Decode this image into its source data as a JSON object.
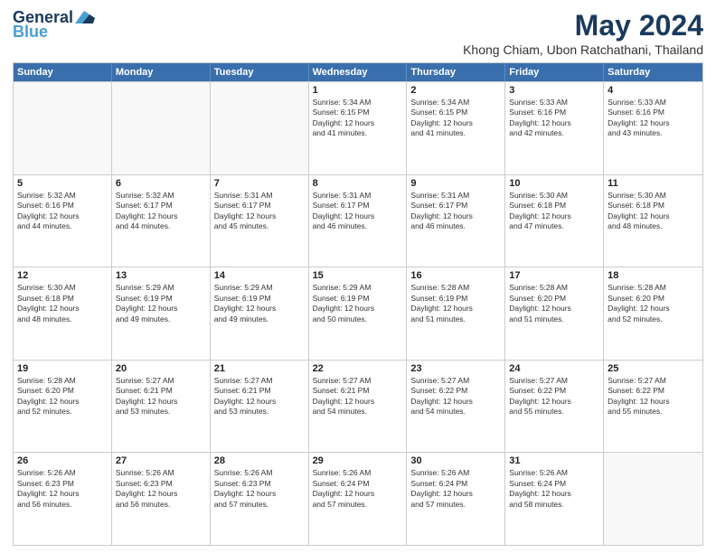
{
  "logo": {
    "line1": "General",
    "line2": "Blue"
  },
  "title": "May 2024",
  "subtitle": "Khong Chiam, Ubon Ratchathani, Thailand",
  "header_days": [
    "Sunday",
    "Monday",
    "Tuesday",
    "Wednesday",
    "Thursday",
    "Friday",
    "Saturday"
  ],
  "weeks": [
    [
      {
        "day": "",
        "info": "",
        "empty": true
      },
      {
        "day": "",
        "info": "",
        "empty": true
      },
      {
        "day": "",
        "info": "",
        "empty": true
      },
      {
        "day": "1",
        "info": "Sunrise: 5:34 AM\nSunset: 6:15 PM\nDaylight: 12 hours\nand 41 minutes."
      },
      {
        "day": "2",
        "info": "Sunrise: 5:34 AM\nSunset: 6:15 PM\nDaylight: 12 hours\nand 41 minutes."
      },
      {
        "day": "3",
        "info": "Sunrise: 5:33 AM\nSunset: 6:16 PM\nDaylight: 12 hours\nand 42 minutes."
      },
      {
        "day": "4",
        "info": "Sunrise: 5:33 AM\nSunset: 6:16 PM\nDaylight: 12 hours\nand 43 minutes."
      }
    ],
    [
      {
        "day": "5",
        "info": "Sunrise: 5:32 AM\nSunset: 6:16 PM\nDaylight: 12 hours\nand 44 minutes."
      },
      {
        "day": "6",
        "info": "Sunrise: 5:32 AM\nSunset: 6:17 PM\nDaylight: 12 hours\nand 44 minutes."
      },
      {
        "day": "7",
        "info": "Sunrise: 5:31 AM\nSunset: 6:17 PM\nDaylight: 12 hours\nand 45 minutes."
      },
      {
        "day": "8",
        "info": "Sunrise: 5:31 AM\nSunset: 6:17 PM\nDaylight: 12 hours\nand 46 minutes."
      },
      {
        "day": "9",
        "info": "Sunrise: 5:31 AM\nSunset: 6:17 PM\nDaylight: 12 hours\nand 46 minutes."
      },
      {
        "day": "10",
        "info": "Sunrise: 5:30 AM\nSunset: 6:18 PM\nDaylight: 12 hours\nand 47 minutes."
      },
      {
        "day": "11",
        "info": "Sunrise: 5:30 AM\nSunset: 6:18 PM\nDaylight: 12 hours\nand 48 minutes."
      }
    ],
    [
      {
        "day": "12",
        "info": "Sunrise: 5:30 AM\nSunset: 6:18 PM\nDaylight: 12 hours\nand 48 minutes."
      },
      {
        "day": "13",
        "info": "Sunrise: 5:29 AM\nSunset: 6:19 PM\nDaylight: 12 hours\nand 49 minutes."
      },
      {
        "day": "14",
        "info": "Sunrise: 5:29 AM\nSunset: 6:19 PM\nDaylight: 12 hours\nand 49 minutes."
      },
      {
        "day": "15",
        "info": "Sunrise: 5:29 AM\nSunset: 6:19 PM\nDaylight: 12 hours\nand 50 minutes."
      },
      {
        "day": "16",
        "info": "Sunrise: 5:28 AM\nSunset: 6:19 PM\nDaylight: 12 hours\nand 51 minutes."
      },
      {
        "day": "17",
        "info": "Sunrise: 5:28 AM\nSunset: 6:20 PM\nDaylight: 12 hours\nand 51 minutes."
      },
      {
        "day": "18",
        "info": "Sunrise: 5:28 AM\nSunset: 6:20 PM\nDaylight: 12 hours\nand 52 minutes."
      }
    ],
    [
      {
        "day": "19",
        "info": "Sunrise: 5:28 AM\nSunset: 6:20 PM\nDaylight: 12 hours\nand 52 minutes."
      },
      {
        "day": "20",
        "info": "Sunrise: 5:27 AM\nSunset: 6:21 PM\nDaylight: 12 hours\nand 53 minutes."
      },
      {
        "day": "21",
        "info": "Sunrise: 5:27 AM\nSunset: 6:21 PM\nDaylight: 12 hours\nand 53 minutes."
      },
      {
        "day": "22",
        "info": "Sunrise: 5:27 AM\nSunset: 6:21 PM\nDaylight: 12 hours\nand 54 minutes."
      },
      {
        "day": "23",
        "info": "Sunrise: 5:27 AM\nSunset: 6:22 PM\nDaylight: 12 hours\nand 54 minutes."
      },
      {
        "day": "24",
        "info": "Sunrise: 5:27 AM\nSunset: 6:22 PM\nDaylight: 12 hours\nand 55 minutes."
      },
      {
        "day": "25",
        "info": "Sunrise: 5:27 AM\nSunset: 6:22 PM\nDaylight: 12 hours\nand 55 minutes."
      }
    ],
    [
      {
        "day": "26",
        "info": "Sunrise: 5:26 AM\nSunset: 6:23 PM\nDaylight: 12 hours\nand 56 minutes."
      },
      {
        "day": "27",
        "info": "Sunrise: 5:26 AM\nSunset: 6:23 PM\nDaylight: 12 hours\nand 56 minutes."
      },
      {
        "day": "28",
        "info": "Sunrise: 5:26 AM\nSunset: 6:23 PM\nDaylight: 12 hours\nand 57 minutes."
      },
      {
        "day": "29",
        "info": "Sunrise: 5:26 AM\nSunset: 6:24 PM\nDaylight: 12 hours\nand 57 minutes."
      },
      {
        "day": "30",
        "info": "Sunrise: 5:26 AM\nSunset: 6:24 PM\nDaylight: 12 hours\nand 57 minutes."
      },
      {
        "day": "31",
        "info": "Sunrise: 5:26 AM\nSunset: 6:24 PM\nDaylight: 12 hours\nand 58 minutes."
      },
      {
        "day": "",
        "info": "",
        "empty": true
      }
    ]
  ]
}
